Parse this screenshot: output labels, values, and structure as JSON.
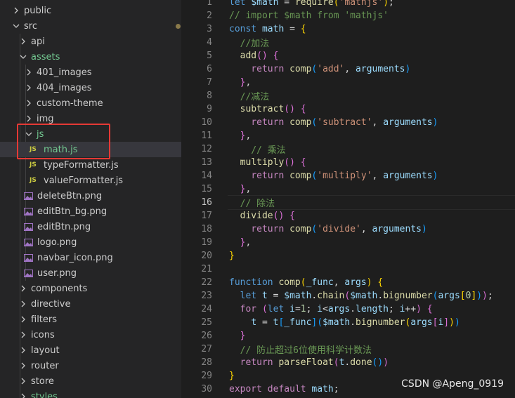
{
  "explorer": {
    "items": [
      {
        "label": "public",
        "expanded": false,
        "status": ""
      },
      {
        "label": "src",
        "expanded": true,
        "status": "dot-muted"
      },
      {
        "label": "api",
        "expanded": false,
        "status": ""
      },
      {
        "label": "assets",
        "expanded": true,
        "status": "dot-green"
      },
      {
        "label": "401_images",
        "expanded": false,
        "status": ""
      },
      {
        "label": "404_images",
        "expanded": false,
        "status": ""
      },
      {
        "label": "custom-theme",
        "expanded": false,
        "status": ""
      },
      {
        "label": "img",
        "expanded": false,
        "status": ""
      },
      {
        "label": "js",
        "expanded": true,
        "status": "dot-green"
      },
      {
        "label": "math.js",
        "type": "js",
        "status": "U"
      },
      {
        "label": "typeFormatter.js",
        "type": "js",
        "status": ""
      },
      {
        "label": "valueFormatter.js",
        "type": "js",
        "status": ""
      },
      {
        "label": "deleteBtn.png",
        "type": "image",
        "status": ""
      },
      {
        "label": "editBtn_bg.png",
        "type": "image",
        "status": ""
      },
      {
        "label": "editBtn.png",
        "type": "image",
        "status": ""
      },
      {
        "label": "logo.png",
        "type": "image",
        "status": ""
      },
      {
        "label": "navbar_icon.png",
        "type": "image",
        "status": ""
      },
      {
        "label": "user.png",
        "type": "image",
        "status": ""
      },
      {
        "label": "components",
        "expanded": false,
        "status": ""
      },
      {
        "label": "directive",
        "expanded": false,
        "status": ""
      },
      {
        "label": "filters",
        "expanded": false,
        "status": ""
      },
      {
        "label": "icons",
        "expanded": false,
        "status": ""
      },
      {
        "label": "layout",
        "expanded": false,
        "status": ""
      },
      {
        "label": "router",
        "expanded": false,
        "status": ""
      },
      {
        "label": "store",
        "expanded": false,
        "status": ""
      },
      {
        "label": "styles",
        "expanded": false,
        "status": ""
      }
    ],
    "js_badge": "JS"
  },
  "editor": {
    "current_line": 16,
    "lines": [
      {
        "no": "1",
        "text": "let $math = require('mathjs');"
      },
      {
        "no": "2",
        "text": "// import $math from 'mathjs'"
      },
      {
        "no": "3",
        "text": "const math = {"
      },
      {
        "no": "4",
        "text": "  //加法"
      },
      {
        "no": "5",
        "text": "  add() {"
      },
      {
        "no": "6",
        "text": "    return comp('add', arguments)"
      },
      {
        "no": "7",
        "text": "  },"
      },
      {
        "no": "8",
        "text": "  //减法"
      },
      {
        "no": "9",
        "text": "  subtract() {"
      },
      {
        "no": "10",
        "text": "    return comp('subtract', arguments)"
      },
      {
        "no": "11",
        "text": "  },"
      },
      {
        "no": "12",
        "text": "    // 乘法"
      },
      {
        "no": "13",
        "text": "  multiply() {"
      },
      {
        "no": "14",
        "text": "    return comp('multiply', arguments)"
      },
      {
        "no": "15",
        "text": "  },"
      },
      {
        "no": "16",
        "text": "  // 除法"
      },
      {
        "no": "17",
        "text": "  divide() {"
      },
      {
        "no": "18",
        "text": "    return comp('divide', arguments)"
      },
      {
        "no": "19",
        "text": "  },"
      },
      {
        "no": "20",
        "text": "}"
      },
      {
        "no": "21",
        "text": ""
      },
      {
        "no": "22",
        "text": "function comp(_func, args) {"
      },
      {
        "no": "23",
        "text": "  let t = $math.chain($math.bignumber(args[0]));"
      },
      {
        "no": "24",
        "text": "  for (let i=1; i<args.length; i++) {"
      },
      {
        "no": "25",
        "text": "    t = t[_func]($math.bignumber(args[i]))"
      },
      {
        "no": "26",
        "text": "  }"
      },
      {
        "no": "27",
        "text": "  // 防止超过6位使用科学计数法"
      },
      {
        "no": "28",
        "text": "  return parseFloat(t.done())"
      },
      {
        "no": "29",
        "text": "}"
      },
      {
        "no": "30",
        "text": "export default math;"
      }
    ]
  },
  "watermark": "CSDN @Apeng_0919",
  "colors": {
    "sidebar_bg": "#252526",
    "editor_bg": "#1e1e1e",
    "highlight_border": "#e53935",
    "git_untracked": "#73c991"
  }
}
